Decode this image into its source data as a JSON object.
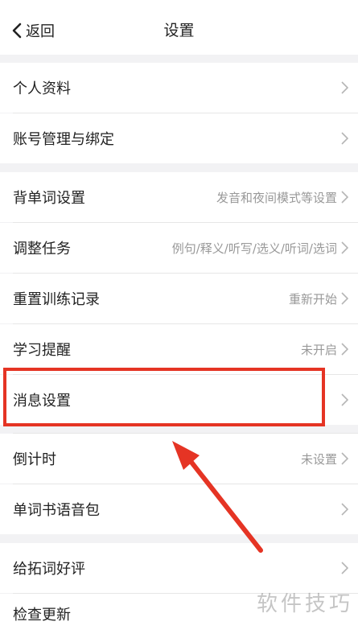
{
  "header": {
    "back_label": "返回",
    "title": "设置"
  },
  "section1": [
    {
      "label": "个人资料",
      "value": ""
    },
    {
      "label": "账号管理与绑定",
      "value": ""
    }
  ],
  "section2": [
    {
      "label": "背单词设置",
      "value": "发音和夜间模式等设置"
    },
    {
      "label": "调整任务",
      "value": "例句/释义/听写/选义/听词/选词"
    },
    {
      "label": "重置训练记录",
      "value": "重新开始"
    },
    {
      "label": "学习提醒",
      "value": "未开启"
    },
    {
      "label": "消息设置",
      "value": ""
    },
    {
      "label": "倒计时",
      "value": "未设置"
    },
    {
      "label": "单词书语音包",
      "value": ""
    }
  ],
  "section3": [
    {
      "label": "给拓词好评",
      "value": ""
    },
    {
      "label": "检查更新",
      "value": ""
    }
  ],
  "annotation": {
    "highlight_color": "#e53424"
  },
  "watermark": "软件技巧"
}
